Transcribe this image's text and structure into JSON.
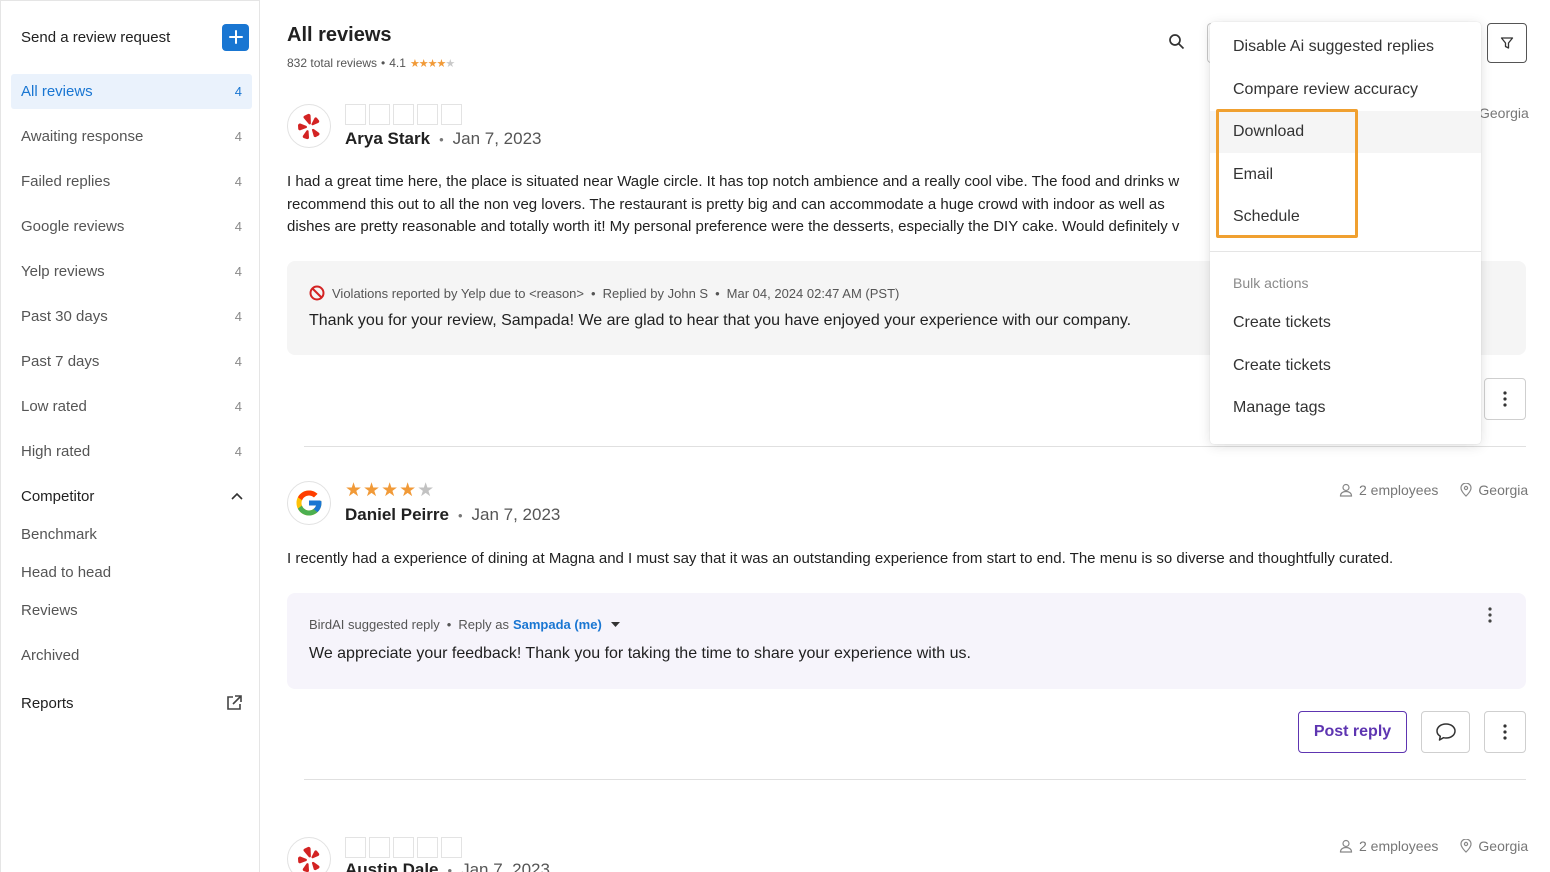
{
  "sidebar": {
    "send_request": "Send a review request",
    "items": [
      {
        "label": "All reviews",
        "count": "4",
        "active": true
      },
      {
        "label": "Awaiting response",
        "count": "4"
      },
      {
        "label": "Failed replies",
        "count": "4"
      },
      {
        "label": "Google reviews",
        "count": "4"
      },
      {
        "label": "Yelp reviews",
        "count": "4"
      },
      {
        "label": "Past 30 days",
        "count": "4"
      },
      {
        "label": "Past 7 days",
        "count": "4"
      },
      {
        "label": "Low rated",
        "count": "4"
      },
      {
        "label": "High rated",
        "count": "4"
      }
    ],
    "competitor": "Competitor",
    "competitor_items": [
      "Benchmark",
      "Head to head",
      "Reviews"
    ],
    "archived": "Archived",
    "reports": "Reports"
  },
  "header": {
    "title": "All reviews",
    "total_reviews": "832 total reviews",
    "bullet": "•",
    "rating": "4.1",
    "rating_stars": 4
  },
  "reviews": [
    {
      "source": "yelp",
      "name": "Arya Stark",
      "date": "Jan 7, 2023",
      "rating": 0,
      "location": "Georgia",
      "text": "I had a great time here, the place is situated near Wagle circle. It has top notch ambience and a really cool vibe. The food and drinks w recommend this out to all the non veg lovers. The restaurant is pretty big and can accommodate a huge crowd with indoor as well as dishes are pretty reasonable and totally worth it! My personal preference were the desserts, especially the DIY cake. Would definitely v",
      "reply_meta": {
        "violation": "Violations reported by Yelp due to <reason>",
        "replied_by": "Replied by John S",
        "timestamp": "Mar 04, 2024 02:47 AM (PST)"
      },
      "reply_text": "Thank you for your review, Sampada! We are glad to hear that you have enjoyed your experience with our company."
    },
    {
      "source": "google",
      "name": "Daniel Peirre",
      "date": "Jan 7, 2023",
      "rating": 4,
      "employees": "2 employees",
      "location": "Georgia",
      "text": "I recently had a experience of dining at Magna and I must say that it was an outstanding experience from start to end. The menu is so diverse and thoughtfully curated.",
      "reply_meta": {
        "suggested": "BirdAI suggested reply",
        "reply_as": "Reply as",
        "reply_as_user": "Sampada (me)"
      },
      "reply_text": "We appreciate your feedback! Thank you for taking the time to share your experience with us.",
      "post_reply": "Post reply"
    },
    {
      "source": "yelp",
      "name": "Austin Dale",
      "date": "Jan 7, 2023",
      "rating": 0,
      "employees": "2 employees",
      "location": "Georgia"
    }
  ],
  "dropdown": {
    "items": [
      "Disable Ai suggested replies",
      "Compare review accuracy",
      "Download",
      "Email",
      "Schedule"
    ],
    "section_label": "Bulk actions",
    "bulk_items": [
      "Create tickets",
      "Create tickets",
      "Manage tags"
    ]
  },
  "colors": {
    "accent": "#1976d2",
    "star": "#f19a38",
    "post_reply": "#5e35b1",
    "highlight": "#f0a030",
    "yelp": "#d32323"
  }
}
